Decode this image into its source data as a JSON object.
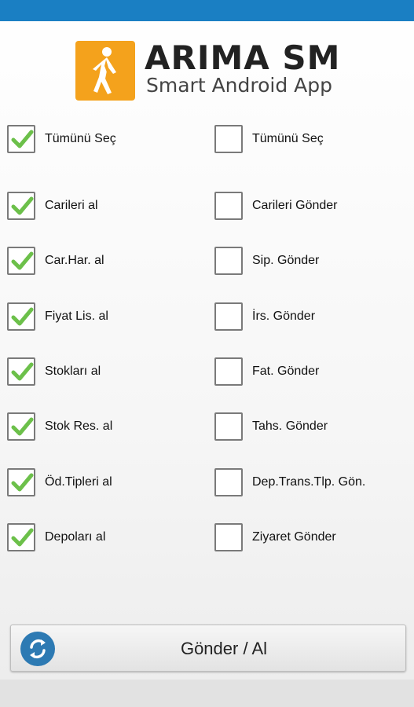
{
  "header": {
    "logo_title": "ARIMA SM",
    "logo_subtitle": "Smart Android App"
  },
  "left_column": [
    {
      "label": "Tümünü Seç",
      "checked": true
    },
    {
      "label": "Carileri al",
      "checked": true
    },
    {
      "label": "Car.Har. al",
      "checked": true
    },
    {
      "label": "Fiyat Lis. al",
      "checked": true
    },
    {
      "label": "Stokları al",
      "checked": true
    },
    {
      "label": "Stok Res. al",
      "checked": true
    },
    {
      "label": "Öd.Tipleri al",
      "checked": true
    },
    {
      "label": "Depoları al",
      "checked": true
    }
  ],
  "right_column": [
    {
      "label": "Tümünü Seç",
      "checked": false
    },
    {
      "label": "Carileri Gönder",
      "checked": false
    },
    {
      "label": "Sip. Gönder",
      "checked": false
    },
    {
      "label": "İrs. Gönder",
      "checked": false
    },
    {
      "label": "Fat. Gönder",
      "checked": false
    },
    {
      "label": "Tahs. Gönder",
      "checked": false
    },
    {
      "label": "Dep.Trans.Tlp. Gön.",
      "checked": false
    },
    {
      "label": "Ziyaret Gönder",
      "checked": false
    }
  ],
  "action_button": {
    "label": "Gönder / Al",
    "icon": "sync-icon"
  },
  "colors": {
    "status_bar": "#1a7fc3",
    "logo_bg": "#f4a21c",
    "check": "#6cc04a",
    "sync_icon_bg": "#2d7ab3"
  }
}
